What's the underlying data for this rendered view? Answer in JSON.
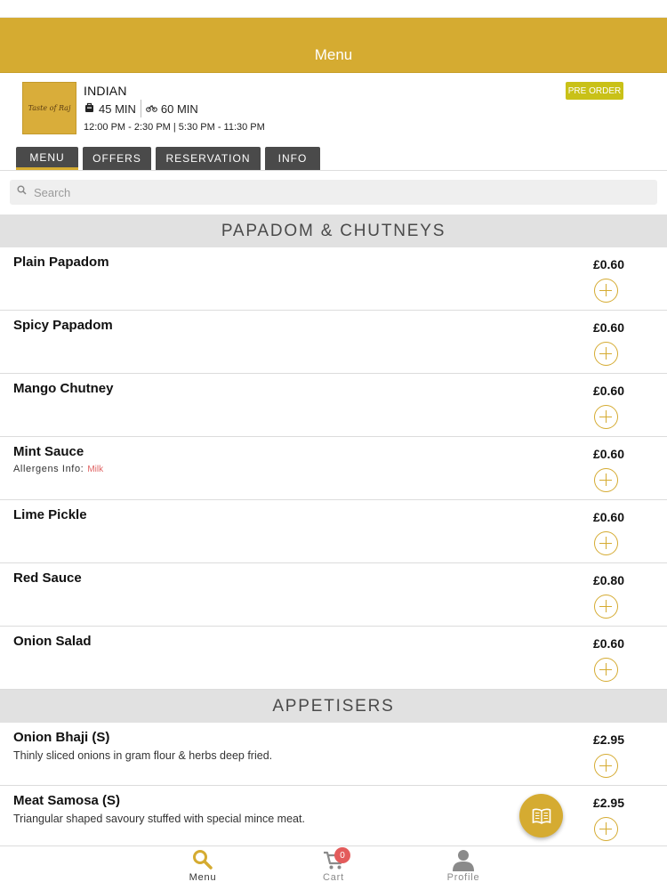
{
  "header": {
    "title": "Menu"
  },
  "restaurant": {
    "logo_text": "Taste of Raj",
    "cuisine": "INDIAN",
    "collection_time": "45 MIN",
    "delivery_time": "60 MIN",
    "hours": "12:00 PM - 2:30 PM | 5:30 PM - 11:30 PM",
    "preorder_label": "PRE ORDER"
  },
  "tabs": [
    {
      "label": "MENU"
    },
    {
      "label": "OFFERS"
    },
    {
      "label": "RESERVATION"
    },
    {
      "label": "INFO"
    }
  ],
  "search": {
    "placeholder": "Search"
  },
  "sections": [
    {
      "title": "PAPADOM & CHUTNEYS",
      "items": [
        {
          "name": "Plain Papadom",
          "price": "£0.60"
        },
        {
          "name": "Spicy Papadom",
          "price": "£0.60"
        },
        {
          "name": "Mango Chutney",
          "price": "£0.60"
        },
        {
          "name": "Mint Sauce",
          "price": "£0.60",
          "allergens_label": "Allergens Info:",
          "allergens_value": "Milk"
        },
        {
          "name": "Lime Pickle",
          "price": "£0.60"
        },
        {
          "name": "Red Sauce",
          "price": "£0.80"
        },
        {
          "name": "Onion Salad",
          "price": "£0.60"
        }
      ]
    },
    {
      "title": "APPETISERS",
      "items": [
        {
          "name": "Onion Bhaji (S)",
          "price": "£2.95",
          "description": "Thinly sliced onions in gram flour & herbs deep fried."
        },
        {
          "name": "Meat Samosa (S)",
          "price": "£2.95",
          "description": "Triangular shaped savoury stuffed with special mince meat."
        }
      ]
    }
  ],
  "bottom_nav": [
    {
      "label": "Menu",
      "icon": "search-icon"
    },
    {
      "label": "Cart",
      "icon": "cart-icon",
      "badge": "0"
    },
    {
      "label": "Profile",
      "icon": "profile-icon"
    }
  ],
  "colors": {
    "accent": "#d5ab31",
    "badge": "#e35b5b",
    "tab_bg": "#4a4a4a"
  }
}
